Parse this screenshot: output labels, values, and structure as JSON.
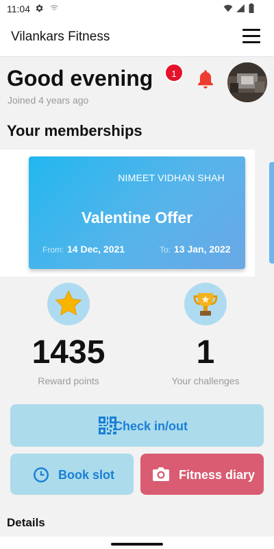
{
  "status_bar": {
    "time": "11:04"
  },
  "app_bar": {
    "title": "Vilankars Fitness"
  },
  "header": {
    "greeting": "Good evening",
    "joined": "Joined 4 years ago",
    "notification_count": "1"
  },
  "memberships": {
    "section_title": "Your memberships",
    "cards": [
      {
        "holder": "NIMEET VIDHAN SHAH",
        "offer": "Valentine Offer",
        "from_label": "From:",
        "from_date": "14 Dec, 2021",
        "to_label": "To:",
        "to_date": "13 Jan, 2022"
      }
    ]
  },
  "stats": {
    "reward_points": {
      "value": "1435",
      "label": "Reward points"
    },
    "challenges": {
      "value": "1",
      "label": "Your challenges"
    }
  },
  "actions": {
    "checkin": "Check in/out",
    "book_slot": "Book slot",
    "fitness_diary": "Fitness diary"
  },
  "details_title": "Details",
  "colors": {
    "accent_blue": "#1a7fd6",
    "button_blue": "#acdbeb",
    "diary_pink": "#d95c72",
    "badge_red": "#e4122a",
    "bell_red": "#ee3b2f"
  },
  "icons": {
    "settings": "gear-icon",
    "cast": "cast-icon",
    "wifi": "wifi-icon",
    "signal": "signal-icon",
    "battery": "battery-icon",
    "menu": "hamburger-menu-icon",
    "notifications": "bell-icon",
    "rewards": "star-icon",
    "challenges": "trophy-icon",
    "checkin": "qr-code-icon",
    "book_slot": "clock-icon",
    "fitness_diary": "camera-icon"
  }
}
